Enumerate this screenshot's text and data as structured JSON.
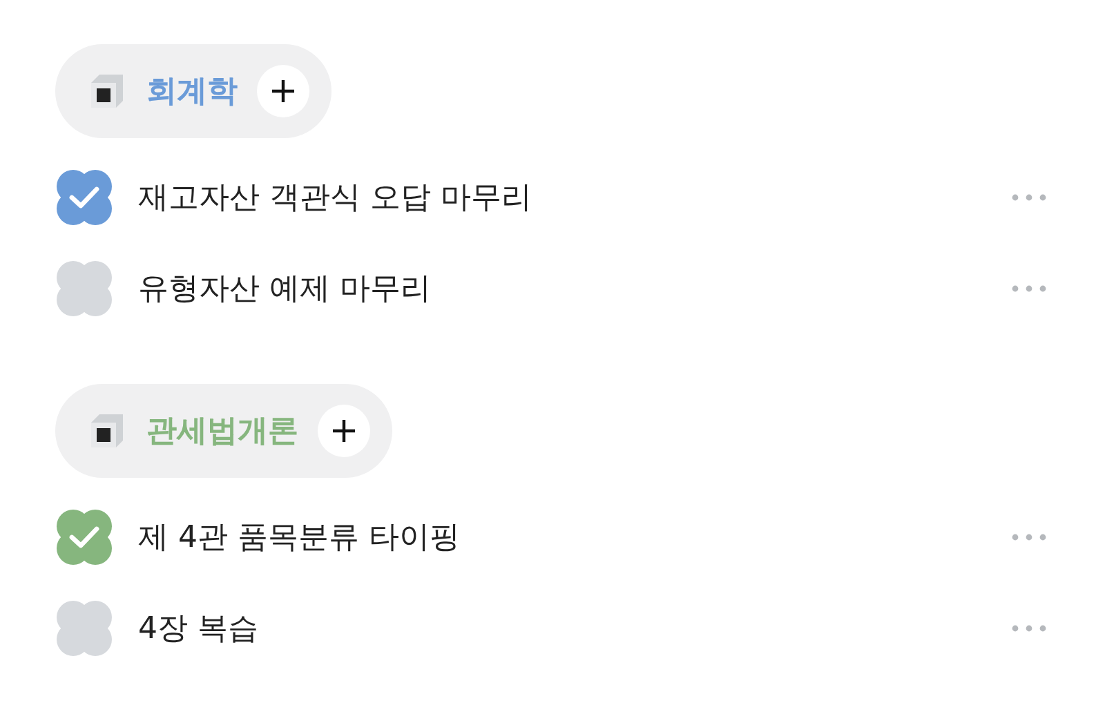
{
  "categories": [
    {
      "name": "회계학",
      "color": "#6a9bd8",
      "tasks": [
        {
          "title": "재고자산 객관식 오답 마무리",
          "checked": true
        },
        {
          "title": "유형자산 예제 마무리",
          "checked": false
        }
      ]
    },
    {
      "name": "관세법개론",
      "color": "#86b67e",
      "tasks": [
        {
          "title": "제 4관 품목분류 타이핑",
          "checked": true
        },
        {
          "title": "4장 복습",
          "checked": false
        }
      ]
    }
  ]
}
